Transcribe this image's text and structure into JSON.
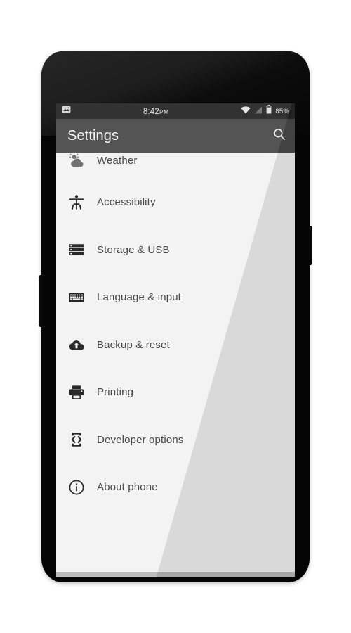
{
  "device": {
    "name": "android-phone-mockup",
    "frame_color": "#050505",
    "screen_bg": "#f2f2f2"
  },
  "status_bar": {
    "background": "#262626",
    "notification_icon": "image-icon",
    "time": "8:42",
    "time_period": "PM",
    "icons": [
      "wifi-icon",
      "no-sim-signal-icon",
      "battery-icon"
    ],
    "battery_percent": "85%"
  },
  "action_bar": {
    "background": "#4a4a4a",
    "title": "Settings",
    "search_icon": "search-icon"
  },
  "list": {
    "items": [
      {
        "label": "Weather",
        "icon": "weather-partly-cloudy-icon"
      },
      {
        "label": "Accessibility",
        "icon": "accessibility-person-icon"
      },
      {
        "label": "Storage & USB",
        "icon": "storage-icon"
      },
      {
        "label": "Language & input",
        "icon": "keyboard-icon"
      },
      {
        "label": "Backup & reset",
        "icon": "cloud-upload-icon"
      },
      {
        "label": "Printing",
        "icon": "printer-icon"
      },
      {
        "label": "Developer options",
        "icon": "developer-options-icon"
      },
      {
        "label": "About phone",
        "icon": "info-circle-icon"
      }
    ]
  },
  "colors": {
    "text_primary": "#3c3c3c",
    "icon": "#1d1d1d",
    "status_text": "#e2e2e2",
    "bottom_strip": "#b9b9b9"
  }
}
